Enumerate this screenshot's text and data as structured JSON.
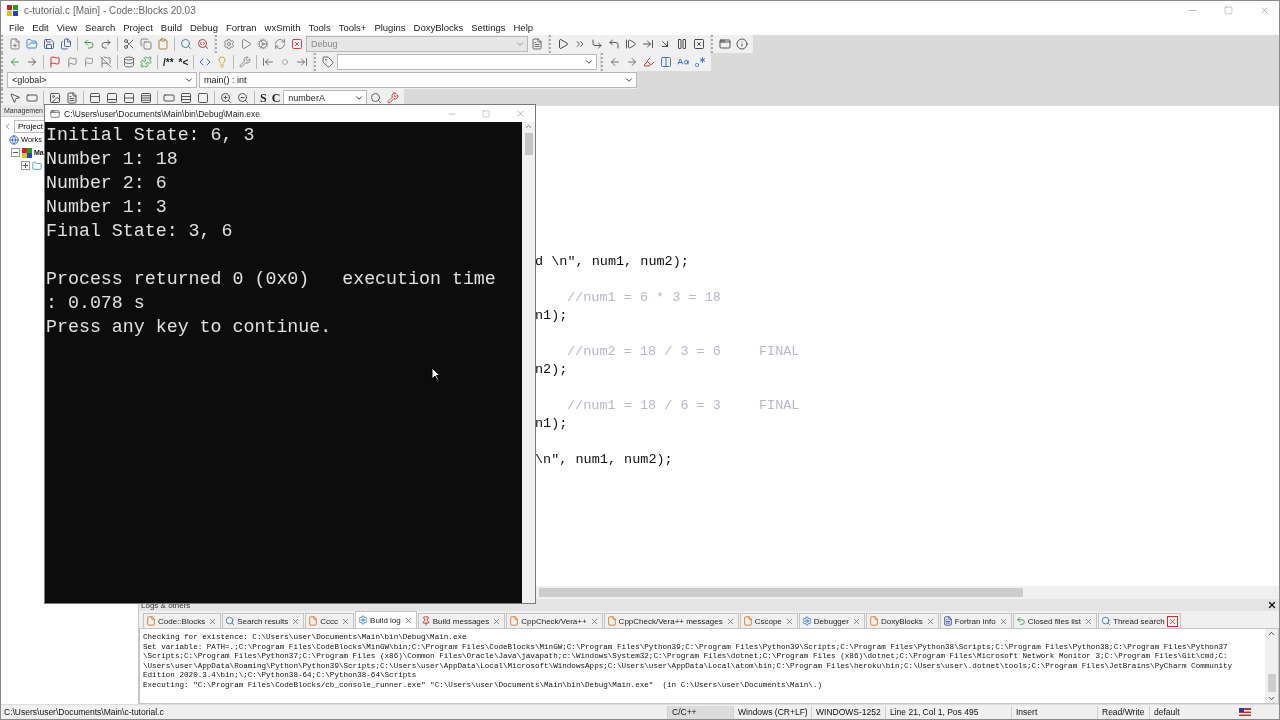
{
  "window": {
    "title": "c-tutorial.c [Main] - Code::Blocks 20.03"
  },
  "menu": [
    "File",
    "Edit",
    "View",
    "Search",
    "Project",
    "Build",
    "Debug",
    "Fortran",
    "wxSmith",
    "Tools",
    "Tools+",
    "Plugins",
    "DoxyBlocks",
    "Settings",
    "Help"
  ],
  "toolbar": {
    "build_target": {
      "value": "Debug",
      "disabled": true
    },
    "comment_buttons": [
      "/**",
      "*<"
    ],
    "scope": {
      "namespace": "<global>",
      "function": "main() : int"
    },
    "symbol_buttons": [
      "S",
      "C"
    ],
    "symbol_combo": "numberA"
  },
  "management": {
    "title": "Managemen",
    "tab": "Project",
    "tree": [
      {
        "label": "Works",
        "children": [
          {
            "label": "Ma",
            "expanded": true,
            "children": [
              {
                "expanded": false
              }
            ]
          }
        ]
      }
    ]
  },
  "console": {
    "title": "C:\\Users\\user\\Documents\\Main\\bin\\Debug\\Main.exe",
    "lines": [
      {
        "kind": "text",
        "text": "Initial State: 6, 3"
      },
      {
        "kind": "text",
        "text": "Number 1: 18"
      },
      {
        "kind": "text",
        "text": "Number 2: 6"
      },
      {
        "kind": "text",
        "text": "Number 1: 3"
      },
      {
        "kind": "text",
        "text": "Final State: 3, 6"
      },
      {
        "kind": "blank"
      },
      {
        "kind": "text",
        "text": "Process returned 0 (0x0)   execution time"
      },
      {
        "kind": "text",
        "text": ": 0.078 s"
      },
      {
        "kind": "text",
        "text": "Press any key to continue."
      }
    ]
  },
  "editor": {
    "lines": [
      {
        "kind": "code",
        "code": "d \\n\", num1, num2);"
      },
      {
        "kind": "blank"
      },
      {
        "kind": "comment",
        "comment": "//num1 = 6 * 3 = 18"
      },
      {
        "kind": "code",
        "code": "n1);"
      },
      {
        "kind": "blank"
      },
      {
        "kind": "comment",
        "comment": "//num2 = 18 / 3 = 6",
        "note": "FINAL"
      },
      {
        "kind": "code",
        "code": "n2);"
      },
      {
        "kind": "blank"
      },
      {
        "kind": "comment",
        "comment": "//num1 = 18 / 6 = 3",
        "note": "FINAL"
      },
      {
        "kind": "code",
        "code": "n1);"
      },
      {
        "kind": "blank"
      },
      {
        "kind": "code",
        "code": "\\n\", num1, num2);"
      }
    ]
  },
  "logs": {
    "title": "Logs & others",
    "tabs": [
      {
        "label": "Code::Blocks",
        "selected": false
      },
      {
        "label": "Search results",
        "selected": false
      },
      {
        "label": "Cccc",
        "selected": false
      },
      {
        "label": "Build log",
        "selected": true
      },
      {
        "label": "Build messages",
        "selected": false
      },
      {
        "label": "CppCheck/Vera++",
        "selected": false
      },
      {
        "label": "CppCheck/Vera++ messages",
        "selected": false
      },
      {
        "label": "Cscope",
        "selected": false
      },
      {
        "label": "Debugger",
        "selected": false
      },
      {
        "label": "DoxyBlocks",
        "selected": false
      },
      {
        "label": "Fortran info",
        "selected": false
      },
      {
        "label": "Closed files list",
        "selected": false
      },
      {
        "label": "Thread search",
        "selected": false
      }
    ],
    "lines": [
      "Checking for existence: C:\\Users\\user\\Documents\\Main\\bin\\Debug\\Main.exe",
      "Set variable: PATH=.;C:\\Program Files\\CodeBlocks\\MinGW\\bin;C:\\Program Files\\CodeBlocks\\MinGW;C:\\Program Files\\Python39;C:\\Program Files\\Python39\\Scripts;C:\\Program Files\\Python38\\Scripts;C:\\Program Files\\Python38;C:\\Program Files\\Python37",
      "\\Scripts;C:\\Program Files\\Python37;C:\\Program Files (x86)\\Common Files\\Oracle\\Java\\javapath;c:\\Windows\\System32;C:\\Program Files\\dotnet;C:\\Program Files (x86)\\dotnet;C:\\Program Files\\Microsoft Network Monitor 3;C:\\Program Files\\Git\\cmd;C:",
      "\\Users\\user\\AppData\\Roaming\\Python\\Python39\\Scripts;C:\\Users\\user\\AppData\\Local\\Microsoft\\WindowsApps;C:\\Users\\user\\AppData\\Local\\atom\\bin;C:\\Program Files\\heroku\\bin;C:\\Users\\user\\.dotnet\\tools;C:\\Program Files\\JetBrains\\PyCharm Community",
      "Edition 2020.3.4\\bin;\\;C:\\Python38-64;C:\\Python38-64\\Scripts",
      "Executing: \"C:\\Program Files\\CodeBlocks/cb_console_runner.exe\" \"C:\\Users\\user\\Documents\\Main\\bin\\Debug\\Main.exe\"  (in C:\\Users\\user\\Documents\\Main\\.)"
    ]
  },
  "status_bar": {
    "path": "C:\\Users\\user\\Documents\\Main\\c-tutorial.c",
    "language": "C/C++",
    "line_endings": "Windows (CR+LF)",
    "encoding": "WINDOWS-1252",
    "position": "Line 21, Col 1, Pos 495",
    "mode": "Insert",
    "access": "Read/Write",
    "theme": "default"
  }
}
